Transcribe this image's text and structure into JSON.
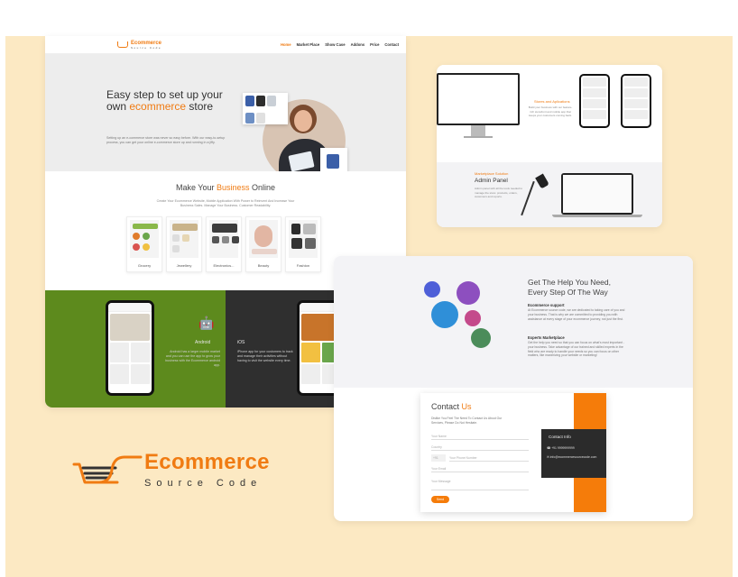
{
  "brand": {
    "name": "Ecommerce",
    "tagline": "Source Code",
    "accent": "#f07b12"
  },
  "nav": {
    "items": [
      "Home",
      "Market Place",
      "Show Case",
      "Addons",
      "Price",
      "Contact"
    ],
    "active": "Home"
  },
  "hero": {
    "title_part1": "Easy step to set up your",
    "title_part2": "own ",
    "title_highlight": "ecommerce",
    "title_part3": " store",
    "description": "Setting up an e-commerce store was never so easy before. With our easy-to-setup process, you can get your online e-commerce store up and running in a jiffy."
  },
  "business": {
    "title_prefix": "Make Your ",
    "title_highlight": "Business",
    "title_suffix": " Online",
    "description": "Create Your Ecommerce Website, Mobile Application With Power to Reinvent And Increase Your Business Sales. Manage Your Business. Customer Readability.",
    "categories": [
      "Grocery",
      "Jewellery",
      "Electronics...",
      "Beauty",
      "Fashion"
    ]
  },
  "apps": {
    "android": {
      "name": "Android",
      "icon": "android-icon",
      "description": "Android has a larger mobile market and you can use the app to grow your business with the Ecommerce android app."
    },
    "ios": {
      "name": "iOS",
      "icon": "apple-icon",
      "description": "iPhone app for your customers to track and manage their activities without having to visit the website every time."
    }
  },
  "showcase": {
    "storefront_title": "Stores and Aplications",
    "storefront_desc": "Build your business with our feature-rich storefront and mobile app that keeps your customers coming back.",
    "admin_label": "Marketplace Solution",
    "admin_title": "Admin Panel",
    "admin_desc": "Admin panel with all the tools needed to manage the store: products, orders, customers and reports."
  },
  "help": {
    "title_line1": "Get The Help You Need,",
    "title_line2": "Every Step Of The Way",
    "support_title": "Ecommerce support",
    "support_text": "At Ecommerce source code, we are dedicated to taking care of you and your business. That is why we are committed to providing you with assistance at every stage of your ecommerce journey, not just the first.",
    "experts_title": "Experts Marketplace",
    "experts_text": "Get the help you need so that you can focus on what's most important - your business. Take advantage of our trained and skilled experts in the field who are ready to handle your needs so you can focus on other matters, like maximizing your website or marketing!"
  },
  "contact": {
    "title_prefix": "Contact ",
    "title_highlight": "Us",
    "intro": "Dislike You Feel The Need To Contact Us About Our Services, Please Do Not Hesitate.",
    "fields": {
      "name": "Your Name",
      "country": "Country",
      "code": "+91",
      "phone": "Your Phone Number",
      "email": "Your Email",
      "message": "Your Message"
    },
    "send_label": "Send",
    "info_title": "Contact Info",
    "phone_value": "+91 9999999999",
    "email_value": "info@ecommercesourcecode.com"
  }
}
